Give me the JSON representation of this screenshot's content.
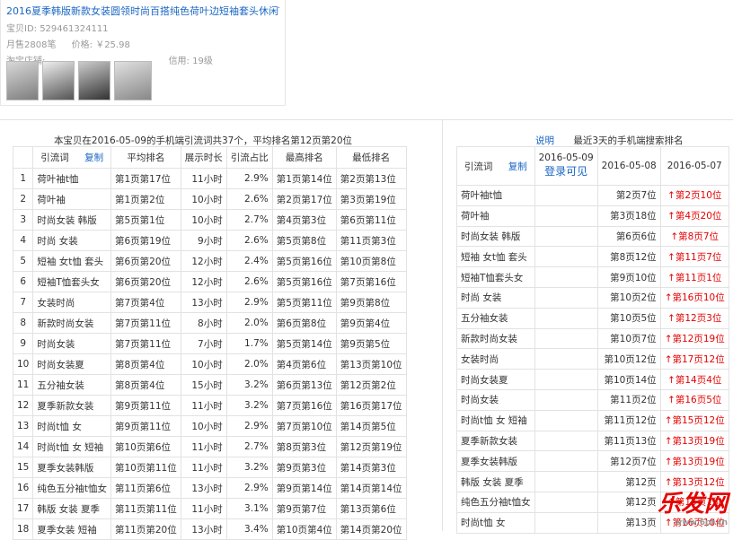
{
  "product": {
    "title": "2016夏季韩版新款女装圆领时尚百搭纯色荷叶边短袖套头休闲T恤女",
    "id_label": "宝贝ID: 529461324111",
    "sales": "月售2808笔",
    "price": "价格: ￥25.98",
    "shop_label": "淘宝店铺:",
    "credit": "信用: 19级"
  },
  "left": {
    "caption": "本宝贝在2016-05-09的手机端引流词共37个，平均排名第12页第20位",
    "headers": [
      "引流词",
      "复制",
      "平均排名",
      "展示时长",
      "引流占比",
      "最高排名",
      "最低排名"
    ],
    "rows": [
      [
        "1",
        "荷叶袖t恤",
        "第1页第17位",
        "11小时",
        "2.9%",
        "第1页第14位",
        "第2页第13位"
      ],
      [
        "2",
        "荷叶袖",
        "第1页第2位",
        "10小时",
        "2.6%",
        "第2页第17位",
        "第3页第19位"
      ],
      [
        "3",
        "时尚女装 韩版",
        "第5页第1位",
        "10小时",
        "2.7%",
        "第4页第3位",
        "第6页第11位"
      ],
      [
        "4",
        "时尚 女装",
        "第6页第19位",
        "9小时",
        "2.6%",
        "第5页第8位",
        "第11页第3位"
      ],
      [
        "5",
        "短袖 女t恤 套头",
        "第6页第20位",
        "12小时",
        "2.4%",
        "第5页第16位",
        "第10页第8位"
      ],
      [
        "6",
        "短袖T恤套头女",
        "第6页第20位",
        "12小时",
        "2.6%",
        "第5页第16位",
        "第7页第16位"
      ],
      [
        "7",
        "女装时尚",
        "第7页第4位",
        "13小时",
        "2.9%",
        "第5页第11位",
        "第9页第8位"
      ],
      [
        "8",
        "新款时尚女装",
        "第7页第11位",
        "8小时",
        "2.0%",
        "第6页第8位",
        "第9页第4位"
      ],
      [
        "9",
        "时尚女装",
        "第7页第11位",
        "7小时",
        "1.7%",
        "第5页第14位",
        "第9页第5位"
      ],
      [
        "10",
        "时尚女装夏",
        "第8页第4位",
        "10小时",
        "2.0%",
        "第4页第6位",
        "第13页第10位"
      ],
      [
        "11",
        "五分袖女装",
        "第8页第4位",
        "15小时",
        "3.2%",
        "第6页第13位",
        "第12页第2位"
      ],
      [
        "12",
        "夏季新款女装",
        "第9页第11位",
        "11小时",
        "3.2%",
        "第7页第16位",
        "第16页第17位"
      ],
      [
        "13",
        "时尚t恤 女",
        "第9页第11位",
        "10小时",
        "2.9%",
        "第7页第10位",
        "第14页第5位"
      ],
      [
        "14",
        "时尚t恤 女 短袖",
        "第10页第6位",
        "11小时",
        "2.7%",
        "第8页第3位",
        "第12页第19位"
      ],
      [
        "15",
        "夏季女装韩版",
        "第10页第11位",
        "11小时",
        "3.2%",
        "第9页第3位",
        "第14页第3位"
      ],
      [
        "16",
        "纯色五分袖t恤女",
        "第11页第6位",
        "13小时",
        "2.9%",
        "第9页第14位",
        "第14页第14位"
      ],
      [
        "17",
        "韩版 女装 夏季",
        "第11页第11位",
        "11小时",
        "3.1%",
        "第9页第7位",
        "第13页第6位"
      ],
      [
        "18",
        "夏季女装 短袖",
        "第11页第20位",
        "13小时",
        "3.4%",
        "第10页第4位",
        "第14页第20位"
      ]
    ]
  },
  "right": {
    "explain_link": "说明",
    "caption": "最近3天的手机端搜索排名",
    "headers": [
      "引流词",
      "复制",
      "2016-05-09",
      "2016-05-08",
      "2016-05-07"
    ],
    "login_text": "登录可见",
    "rows": [
      [
        "荷叶袖t恤",
        "第2页7位",
        "第2页10位"
      ],
      [
        "荷叶袖",
        "第3页18位",
        "第4页20位"
      ],
      [
        "时尚女装 韩版",
        "第6页6位",
        "第8页7位"
      ],
      [
        "短袖 女t恤 套头",
        "第8页12位",
        "第11页7位"
      ],
      [
        "短袖T恤套头女",
        "第9页10位",
        "第11页1位"
      ],
      [
        "时尚 女装",
        "第10页2位",
        "第16页10位"
      ],
      [
        "五分袖女装",
        "第10页5位",
        "第12页3位"
      ],
      [
        "新款时尚女装",
        "第10页7位",
        "第12页19位"
      ],
      [
        "女装时尚",
        "第10页12位",
        "第17页12位"
      ],
      [
        "时尚女装夏",
        "第10页14位",
        "第14页4位"
      ],
      [
        "时尚女装",
        "第11页2位",
        "第16页5位"
      ],
      [
        "时尚t恤 女 短袖",
        "第11页12位",
        "第15页12位"
      ],
      [
        "夏季新款女装",
        "第11页13位",
        "第13页19位"
      ],
      [
        "夏季女装韩版",
        "第12页7位",
        "第13页19位"
      ],
      [
        "韩版 女装 夏季",
        "第12页",
        "第13页12位"
      ],
      [
        "纯色五分袖t恤女",
        "第12页",
        "第15页1位"
      ],
      [
        "时尚t恤 女",
        "第13页",
        "第16页10位"
      ]
    ]
  },
  "watermark": {
    "text": "乐发网",
    "url": "www.6pf.cn"
  }
}
